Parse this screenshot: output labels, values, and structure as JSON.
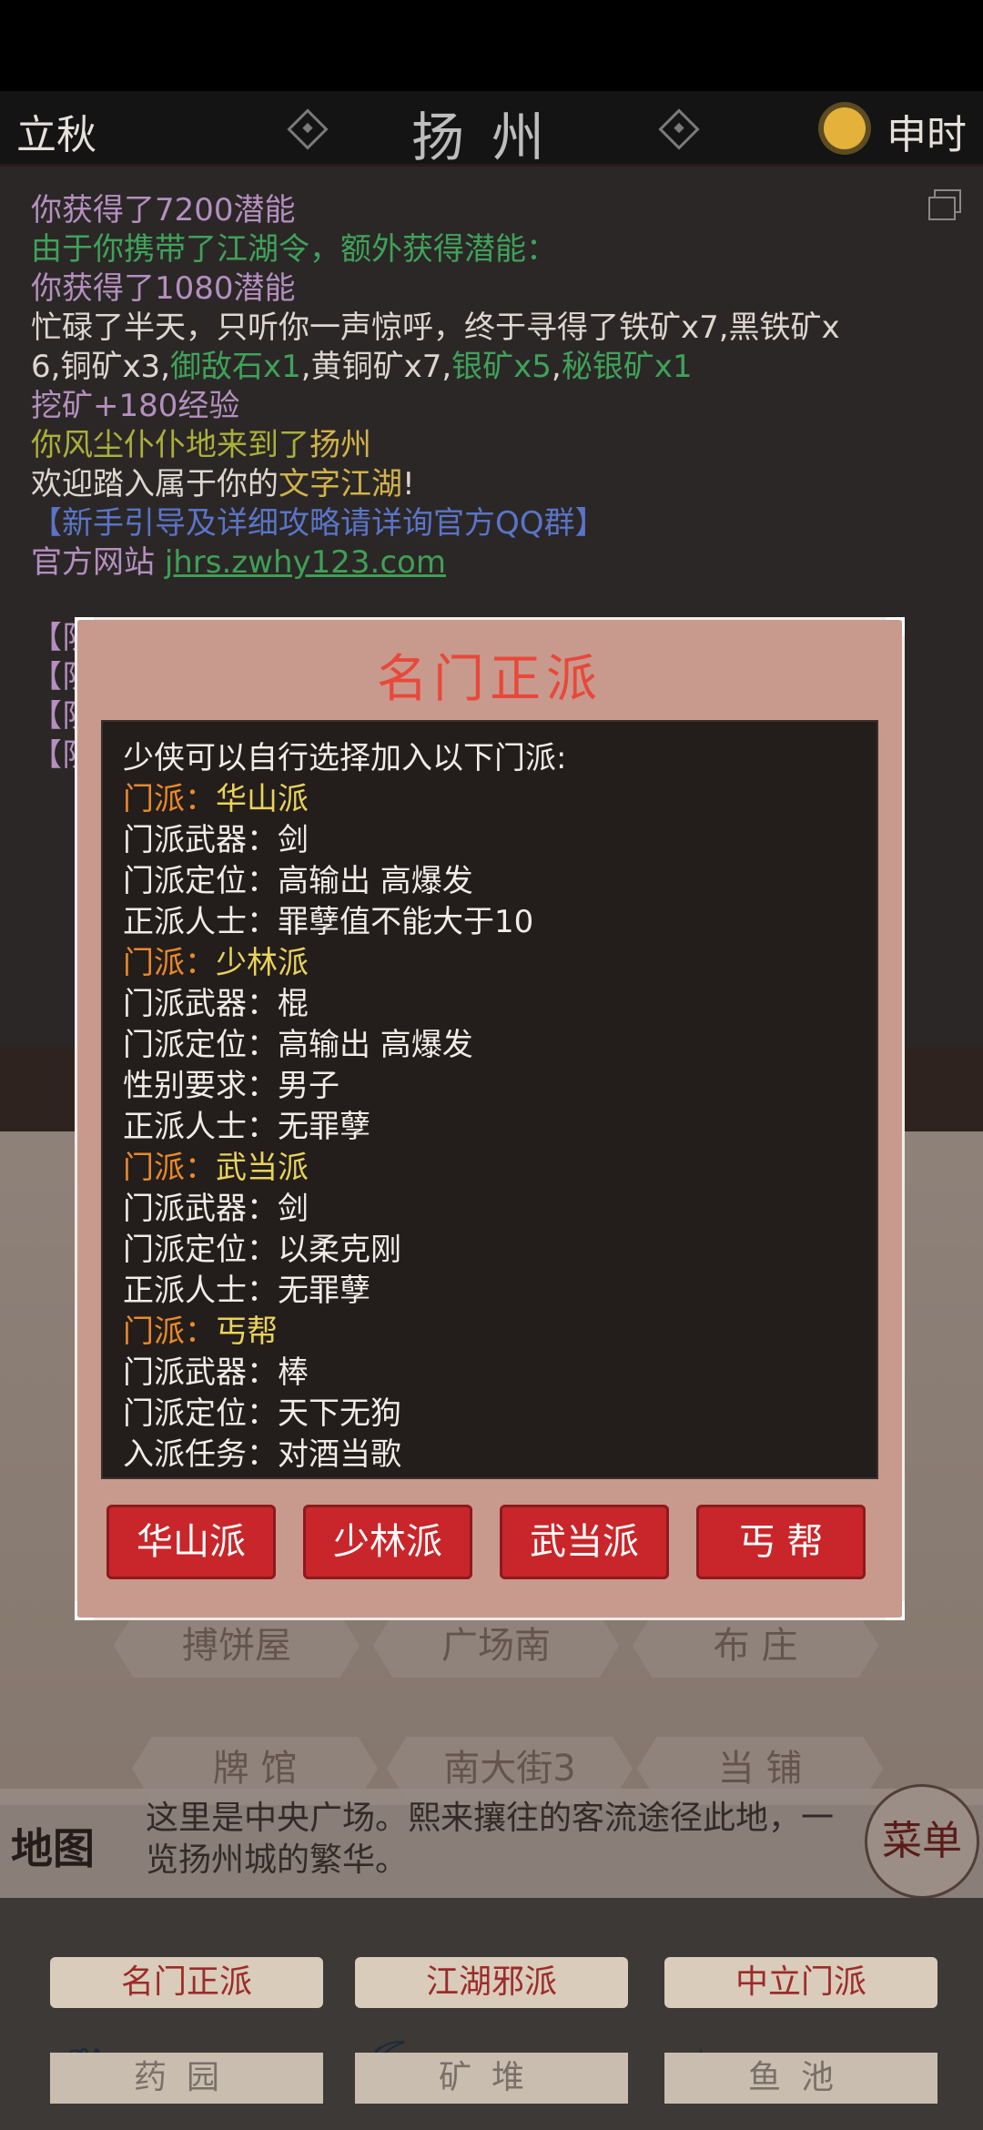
{
  "header": {
    "solar_term": "立秋",
    "city": "扬州",
    "hour": "申时"
  },
  "log": {
    "lines": [
      "你获得了7200潜能",
      "由于你携带了江湖令，额外获得潜能：",
      "你获得了1080潜能",
      "忙碌了半天，只听你一声惊呼，终于寻得了铁矿x7,黑铁矿x",
      "6,铜矿x3,",
      "御敌石x1",
      ",黄铜矿x7,",
      "银矿x5",
      ",",
      "秘银矿x1",
      "挖矿+180经验",
      "你风尘仆仆地来到了",
      "扬州",
      "欢迎踏入属于你的",
      "文字江湖",
      "!",
      "【新手引导及详细攻略请详询官方QQ群】",
      "官方网站 ",
      "jhrs.zwhy123.com"
    ],
    "team_prefix": "【队伍】"
  },
  "map": {
    "nodes": [
      "搏饼屋",
      "广场南",
      "布 庄",
      "牌 馆",
      "南大街3",
      "当 铺"
    ],
    "description": "这里是中央广场。熙来攘往的客流途径此地，一览扬州城的繁华。",
    "label": "地图",
    "menu": "菜单"
  },
  "bottom": {
    "factions": [
      "名门正派",
      "江湖邪派",
      "中立门派"
    ],
    "places": [
      "药园",
      "矿堆",
      "鱼池"
    ]
  },
  "modal": {
    "title": "名门正派",
    "intro": "少侠可以自行选择加入以下门派:",
    "sects": [
      {
        "name": "华山派",
        "rows": [
          [
            "门派武器：",
            "剑"
          ],
          [
            "门派定位：",
            "高输出 高爆发"
          ],
          [
            "正派人士：",
            "罪孽值不能大于10"
          ]
        ]
      },
      {
        "name": "少林派",
        "rows": [
          [
            "门派武器：",
            "棍"
          ],
          [
            "门派定位：",
            "高输出 高爆发"
          ],
          [
            "性别要求：",
            "男子"
          ],
          [
            "正派人士：",
            "无罪孽"
          ]
        ]
      },
      {
        "name": "武当派",
        "rows": [
          [
            "门派武器：",
            "剑"
          ],
          [
            "门派定位：",
            "以柔克刚"
          ],
          [
            "正派人士：",
            "无罪孽"
          ]
        ]
      },
      {
        "name": "丐帮",
        "rows": [
          [
            "门派武器：",
            "棒"
          ],
          [
            "门派定位：",
            "天下无狗"
          ],
          [
            "入派任务：",
            "对酒当歌"
          ]
        ]
      }
    ],
    "sect_label": "门派：",
    "buttons": [
      "华山派",
      "少林派",
      "武当派",
      "丐 帮"
    ]
  },
  "colors": {
    "accent_red": "#c8262a",
    "title_red": "#e8483a",
    "sect_key_orange": "#e98a2b",
    "sect_value_yellow": "#e8d35a"
  }
}
